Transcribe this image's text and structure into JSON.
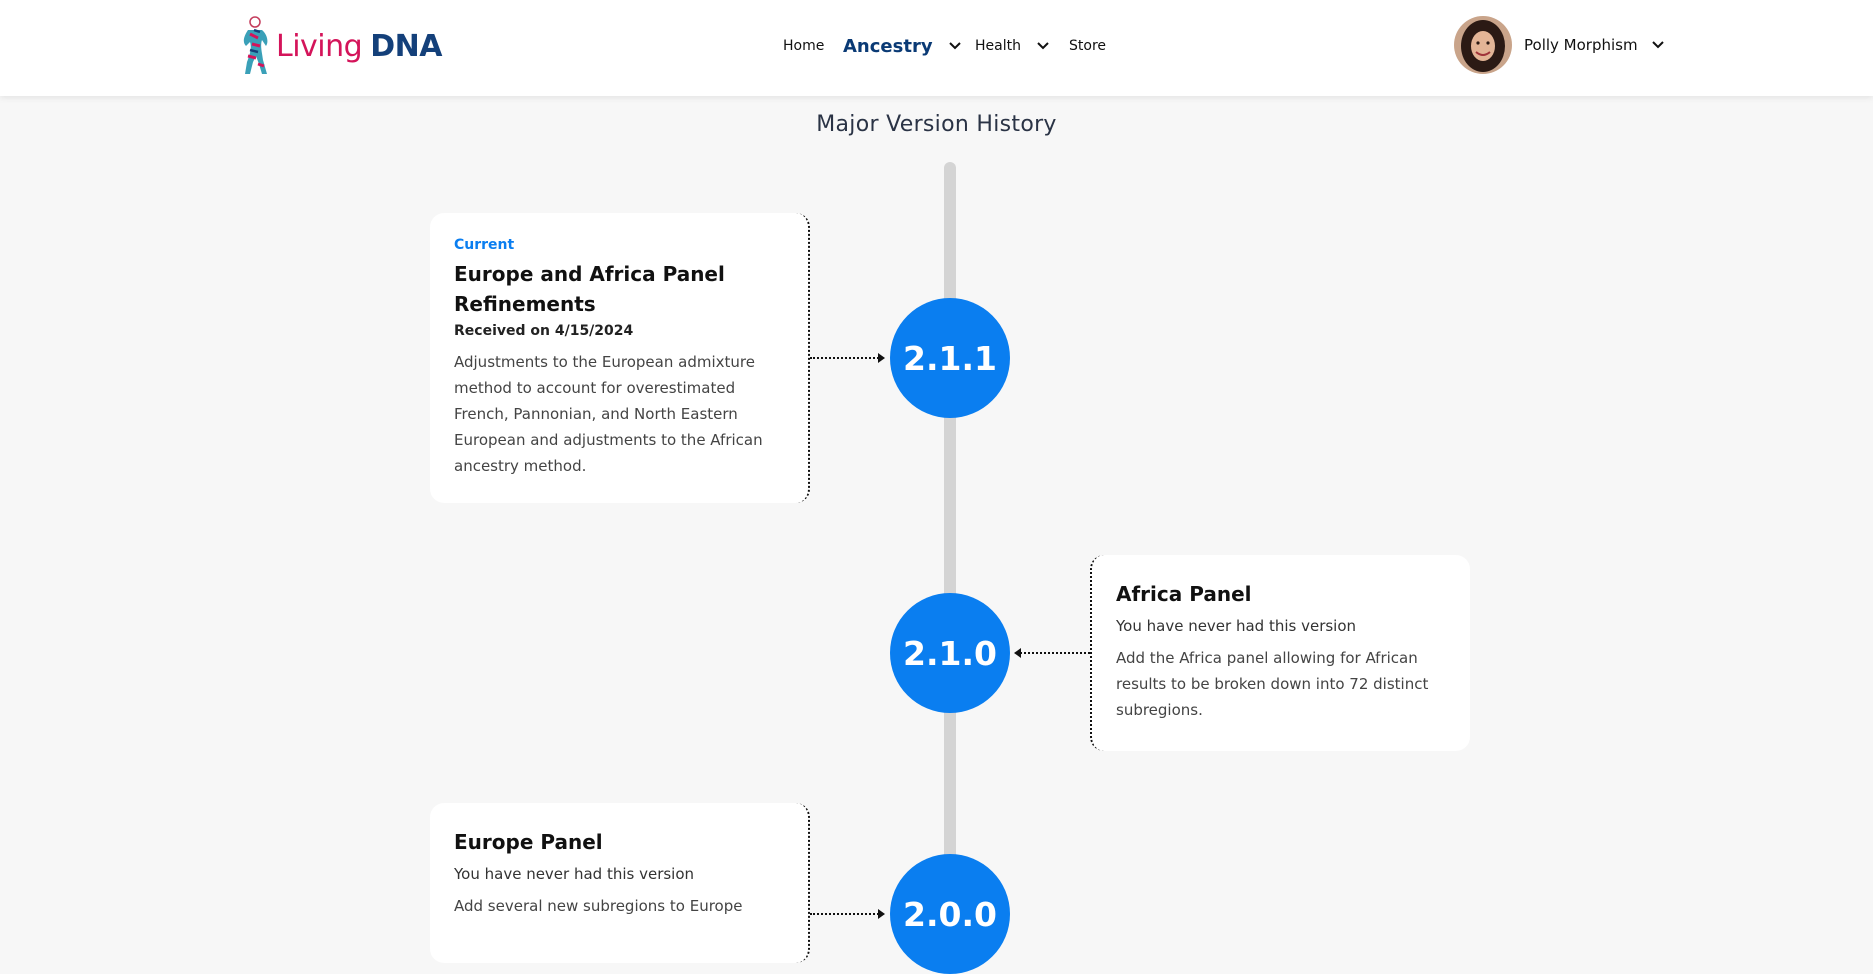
{
  "header": {
    "logo": {
      "word1": "Living",
      "word2": "DNA"
    },
    "nav": {
      "home": "Home",
      "ancestry": "Ancestry",
      "health": "Health",
      "store": "Store"
    },
    "user": {
      "name": "Polly Morphism"
    }
  },
  "main": {
    "title": "Major Version History",
    "versions": [
      {
        "number": "2.1.1",
        "status": "Current",
        "title": "Europe and Africa Panel Refinements",
        "received": "Received on 4/15/2024",
        "description": "Adjustments to the European admixture method to account for overestimated French, Pannonian, and North Eastern European and adjustments to the African ancestry method."
      },
      {
        "number": "2.1.0",
        "title": "Africa Panel",
        "subtitle": "You have never had this version",
        "description": "Add the Africa panel allowing for African results to be broken down into 72 distinct subregions."
      },
      {
        "number": "2.0.0",
        "title": "Europe Panel",
        "subtitle": "You have never had this version",
        "description": "Add several new subregions to Europe"
      }
    ]
  },
  "colors": {
    "accent": "#0a7ef0",
    "brand_pink": "#d4145a",
    "brand_navy": "#14407a",
    "background": "#f7f7f7"
  }
}
